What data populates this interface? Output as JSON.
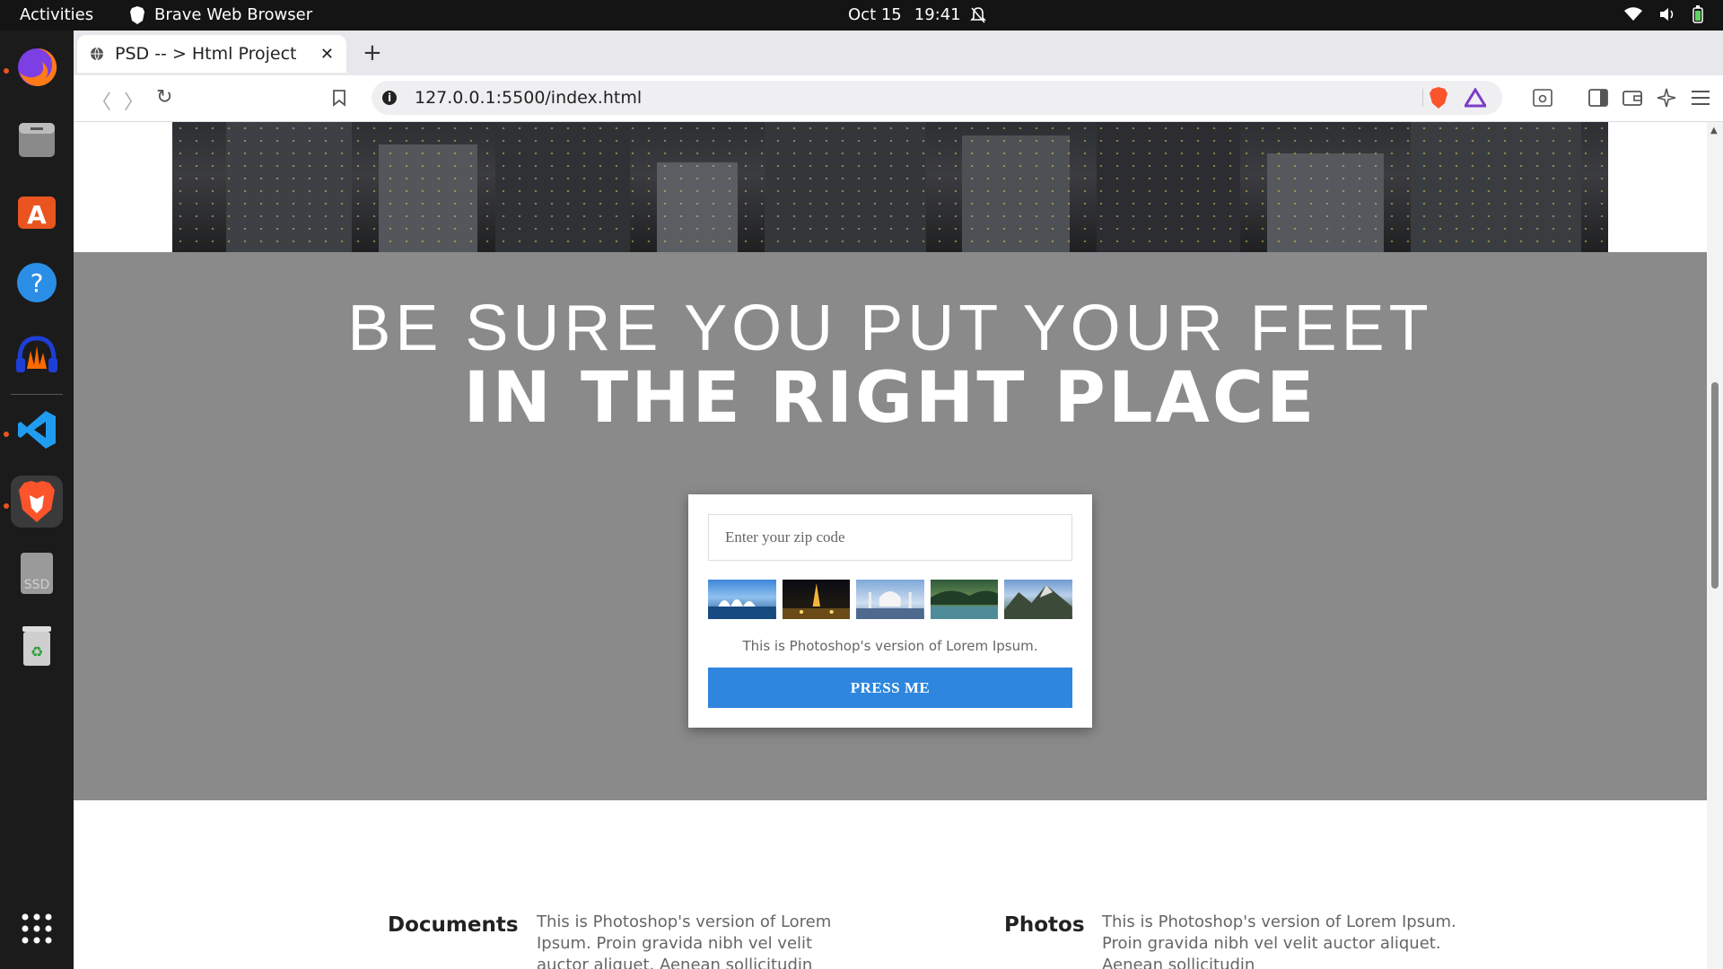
{
  "system": {
    "activities": "Activities",
    "app_name": "Brave Web Browser",
    "date": "Oct 15",
    "time": "19:41"
  },
  "browser": {
    "tab_title": "PSD -- > Html Project",
    "url": "127.0.0.1:5500/index.html"
  },
  "hero": {
    "line1": "BE SURE YOU PUT YOUR FEET",
    "line2": "IN THE RIGHT PLACE"
  },
  "card": {
    "zip_placeholder": "Enter your zip code",
    "thumbnails": [
      "sydney-opera-house",
      "eiffel-tower-night",
      "taj-mahal",
      "river-landscape",
      "mountain-lake"
    ],
    "caption": "This is Photoshop's version of Lorem Ipsum.",
    "button_label": "PRESS ME"
  },
  "features": [
    {
      "title": "Documents",
      "text": "This is Photoshop's version of Lorem Ipsum. Proin gravida nibh vel velit auctor aliquet. Aenean sollicitudin"
    },
    {
      "title": "Photos",
      "text": "This is Photoshop's version of Lorem Ipsum. Proin gravida nibh vel velit auctor aliquet. Aenean sollicitudin"
    }
  ],
  "colors": {
    "accent": "#2e86de",
    "hero_bg": "#8a8a8a",
    "ubuntu_orange": "#e95420"
  }
}
